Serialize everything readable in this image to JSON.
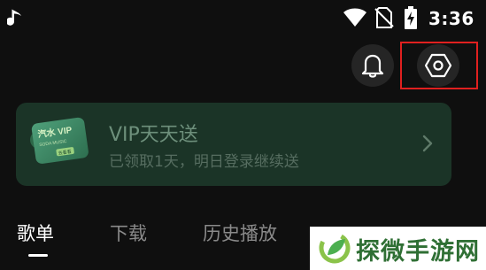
{
  "status_bar": {
    "time": "3:36",
    "icons": [
      "music-note-icon",
      "wifi-icon",
      "no-sim-icon",
      "battery-charging-icon"
    ]
  },
  "header": {
    "icons": [
      "bell-icon",
      "settings-hexagon-icon"
    ],
    "highlight_color": "#e0201f"
  },
  "vip_banner": {
    "card_text": "汽水 VIP",
    "card_subtext": "SODA MUSIC",
    "card_badge": "去看看",
    "title": "VIP天天送",
    "subtitle": "已领取1天，明日登录继续送",
    "background_color": "#1b3427"
  },
  "tabs": [
    {
      "label": "歌单",
      "active": true
    },
    {
      "label": "下载",
      "active": false
    },
    {
      "label": "历史播放",
      "active": false
    }
  ],
  "watermark": {
    "text": "探微手游网",
    "color": "#2f6f34"
  }
}
